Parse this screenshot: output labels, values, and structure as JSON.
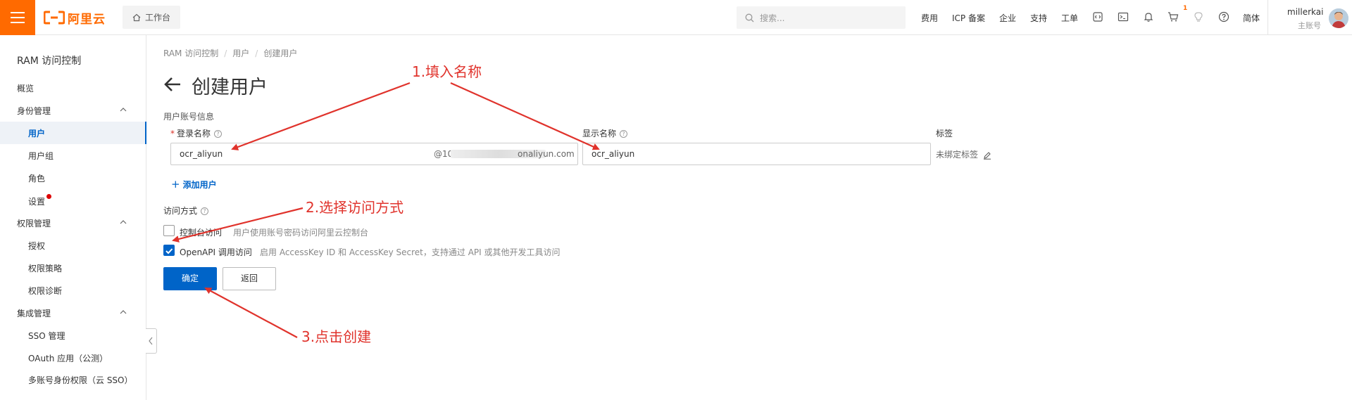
{
  "app": {
    "logo_text": "阿里云",
    "home_tab": "工作台"
  },
  "search": {
    "placeholder": "搜索..."
  },
  "topnav": {
    "items": [
      "费用",
      "ICP 备案",
      "企业",
      "支持",
      "工单"
    ],
    "language": "简体",
    "cart_badge": "1",
    "username": "millerkai",
    "account_type": "主账号"
  },
  "sidebar": {
    "title": "RAM 访问控制",
    "overview": "概览",
    "identity_group": "身份管理",
    "users": "用户",
    "user_groups": "用户组",
    "roles": "角色",
    "settings": "设置",
    "permission_group": "权限管理",
    "grants": "授权",
    "policies": "权限策略",
    "diagnosis": "权限诊断",
    "integration_group": "集成管理",
    "sso": "SSO 管理",
    "oauth": "OAuth 应用（公测）",
    "multi_account": "多账号身份权限（云 SSO）"
  },
  "breadcrumb": [
    "RAM 访问控制",
    "用户",
    "创建用户"
  ],
  "page_title": "创建用户",
  "form": {
    "section_title": "用户账号信息",
    "login_name_label": "登录名称",
    "login_name_value": "ocr_aliyun",
    "login_suffix_start": "@10",
    "login_suffix_end": "onaliyun.com",
    "display_name_label": "显示名称",
    "display_name_value": "ocr_aliyun",
    "tags_label": "标签",
    "tags_value": "未绑定标签",
    "add_user": "添加用户",
    "access_label": "访问方式",
    "console_access_label": "控制台访问",
    "console_access_desc": "用户使用账号密码访问阿里云控制台",
    "console_access_checked": false,
    "openapi_label": "OpenAPI 调用访问",
    "openapi_desc": "启用 AccessKey ID 和 AccessKey Secret，支持通过 API 或其他开发工具访问",
    "openapi_checked": true,
    "confirm_button": "确定",
    "back_button": "返回"
  },
  "annotations": {
    "step1": "1.填入名称",
    "step2": "2.选择访问方式",
    "step3": "3.点击创建"
  },
  "colors": {
    "brand": "#ff6a00",
    "primary": "#0064c8",
    "annotation": "#e0332c"
  }
}
